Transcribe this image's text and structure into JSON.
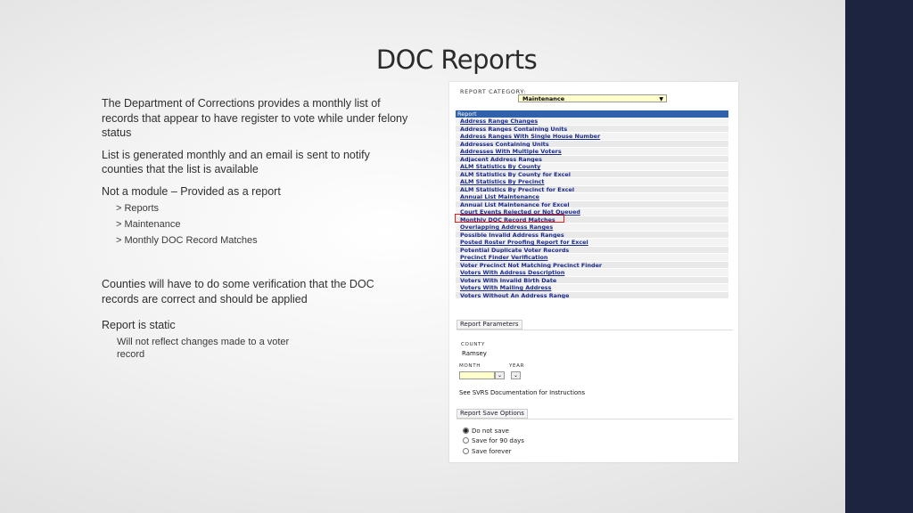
{
  "slide": {
    "title": "DOC Reports",
    "paragraphs": {
      "p1": "The Department of Corrections provides a monthly list of records that appear to have register to vote while under felony status",
      "p2": "List is generated monthly and an email is sent to notify counties that the list is available",
      "p3": "Not a module – Provided as a report",
      "path": [
        "> Reports",
        "> Maintenance",
        "> Monthly DOC Record Matches"
      ],
      "p4": "Counties will have to do some verification that the DOC records are correct and should be applied",
      "p5": "Report is static",
      "p5_sub": "Will not reflect changes made to a voter record"
    },
    "colors": {
      "side_band": "#1c2440",
      "highlight_box": "#e0221f"
    }
  },
  "screenshot": {
    "category_label": "Report Category:",
    "category_value": "Maintenance",
    "report_header": "Report",
    "reports": [
      "Address Range Changes",
      "Address Ranges Containing Units",
      "Address Ranges With Single House Number",
      "Addresses Containing Units",
      "Addresses With Multiple Voters",
      "Adjacent Address Ranges",
      "ALM Statistics By County",
      "ALM Statistics By County for Excel",
      "ALM Statistics By Precinct",
      "ALM Statistics By Precinct for Excel",
      "Annual List Maintenance",
      "Annual List Maintenance for Excel",
      "Court Events Rejected or Not Queued",
      "Monthly DOC Record Matches",
      "Overlapping Address Ranges",
      "Possible Invalid Address Ranges",
      "Posted Roster Proofing Report for Excel",
      "Potential Duplicate Voter Records",
      "Precinct Finder Verification",
      "Voter Precinct Not Matching Precinct Finder",
      "Voters With Address Description",
      "Voters With Invalid Birth Date",
      "Voters With Mailing Address",
      "Voters Without An Address Range"
    ],
    "highlighted_report": "Monthly DOC Record Matches",
    "params": {
      "section_label": "Report Parameters",
      "county_label": "County",
      "county_value": "Ramsey",
      "month_label": "Month",
      "year_label": "Year",
      "doc_note": "See SVRS Documentation for Instructions"
    },
    "save": {
      "section_label": "Report Save Options",
      "options": [
        "Do not save",
        "Save for 90 days",
        "Save forever"
      ],
      "selected": "Do not save"
    }
  }
}
